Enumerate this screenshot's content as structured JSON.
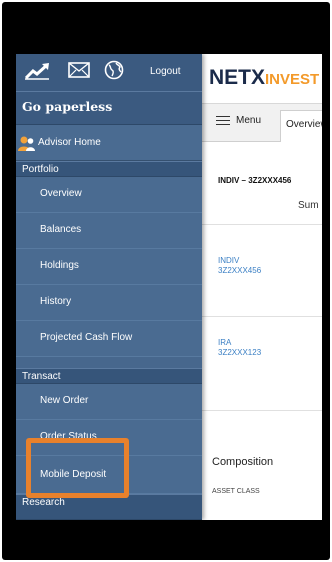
{
  "header": {
    "logout_label": "Logout",
    "icons": [
      "chart-icon",
      "mail-icon",
      "globe-icon"
    ]
  },
  "sidebar": {
    "banner": "Go paperless",
    "advisor_home": "Advisor Home",
    "sections": [
      {
        "label": "Portfolio",
        "items": [
          "Overview",
          "Balances",
          "Holdings",
          "History",
          "Projected Cash Flow"
        ]
      },
      {
        "label": "Transact",
        "items": [
          "New Order",
          "Order Status",
          "Mobile Deposit"
        ]
      },
      {
        "label": "Research",
        "items": []
      }
    ]
  },
  "main": {
    "brand": {
      "part1": "NETX",
      "part2": "INVEST"
    },
    "menu_label": "Menu",
    "tab_label": "Overview",
    "account_title": "INDIV – 3Z2XXX456",
    "summary_label": "Sum",
    "accounts": [
      {
        "type": "INDIV",
        "number": "3Z2XXX456"
      },
      {
        "type": "IRA",
        "number": "3Z2XXX123"
      }
    ],
    "composition_label": "Composition",
    "asset_class_label": "ASSET CLASS"
  },
  "highlight_color": "#e8812c",
  "nav_color": "#47678d",
  "brand_color": "#1b2b4a",
  "brand_accent": "#f39a2a"
}
